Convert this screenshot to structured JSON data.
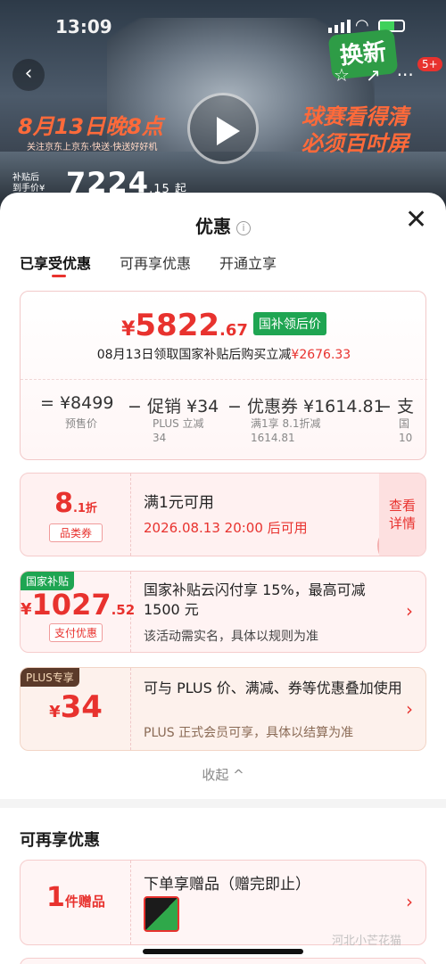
{
  "status": {
    "time": "13:09"
  },
  "bg": {
    "swap_badge": "换新",
    "count_badge": "5+",
    "promo_date": "8月13日晚8点",
    "promo_sub": "关注京东上京东·快送·快送好好机",
    "slogan_line1": "球赛看得清",
    "slogan_line2": "必须百吋屏",
    "subsidy_line1": "补贴后",
    "subsidy_line2": "到手价¥",
    "price": "7224",
    "price_suffix": ".15 起"
  },
  "sheet": {
    "title": "优惠",
    "info": "i",
    "close": "✕",
    "tabs": [
      "已享受优惠",
      "可再享优惠",
      "开通立享"
    ]
  },
  "price_card": {
    "yen": "¥",
    "int": "5822",
    "dec": ".67",
    "tag": "国补领后价",
    "desc": "08月13日领取国家补贴后购买立减",
    "desc_amount": "¥2676.33",
    "calc": [
      {
        "op": "=",
        "value": "¥8499",
        "sub1": "预售价",
        "sub2": ""
      },
      {
        "op": "−",
        "value": "促销 ¥34",
        "sub1": "PLUS 立减",
        "sub2": "34"
      },
      {
        "op": "−",
        "value": "优惠券 ¥1614.81",
        "sub1": "满1享 8.1折减",
        "sub2": "1614.81"
      },
      {
        "op": "−",
        "value": "支",
        "sub1": "国",
        "sub2": "10"
      }
    ]
  },
  "coupons": {
    "c1": {
      "big": "8",
      "big_small": ".1折",
      "tag": "品类券",
      "title": "满1元可用",
      "date": "2026.08.13 20:00 后可用",
      "detail1": "查看",
      "detail2": "详情",
      "stamp": "已领"
    },
    "c2": {
      "label": "国家补贴",
      "yen": "¥",
      "int": "1027",
      "dec": ".52",
      "tag": "支付优惠",
      "title": "国家补贴云闪付享 15%，最高可减 1500 元",
      "note": "该活动需实名，具体以规则为准"
    },
    "c3": {
      "label": "PLUS专享",
      "yen": "¥",
      "int": "34",
      "title": "可与 PLUS 价、满减、券等优惠叠加使用",
      "note": "PLUS 正式会员可享，具体以结算为准"
    },
    "collapse": "收起 ^",
    "section2": "可再享优惠",
    "c4": {
      "big": "1",
      "big_small": "件赠品",
      "title": "下单享赠品（赠完即止）"
    }
  },
  "watermark": "河北小芒花猫"
}
